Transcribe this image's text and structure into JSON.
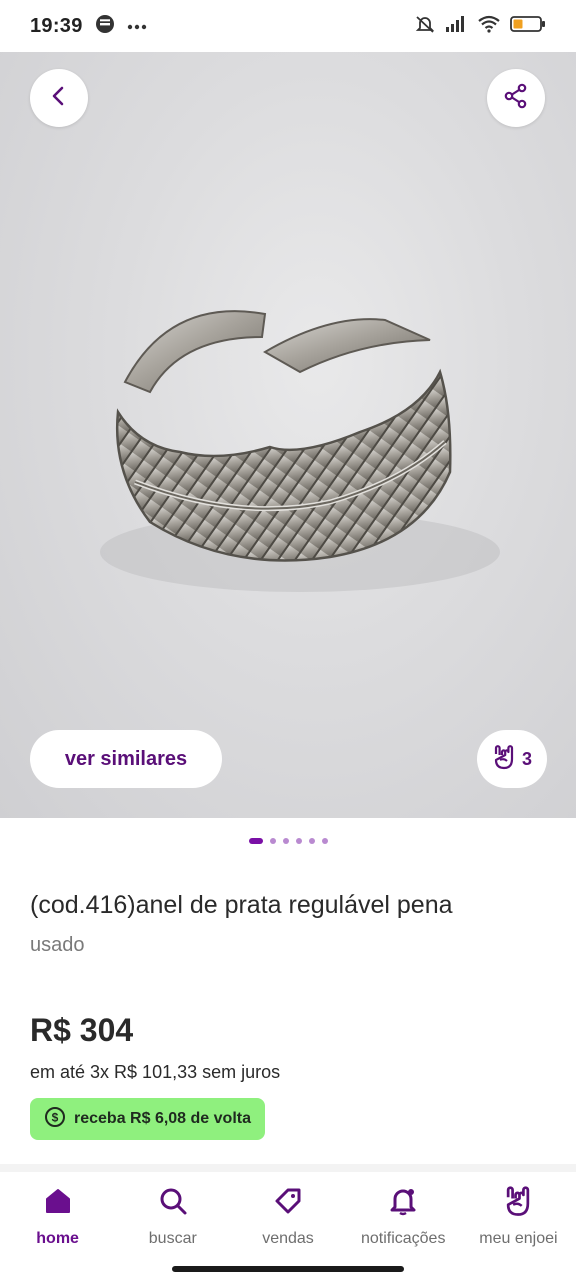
{
  "status_bar": {
    "time": "19:39",
    "icons": [
      "app-e-icon",
      "more-dots-icon",
      "bell-off-icon",
      "signal-icon",
      "wifi-icon",
      "battery-icon"
    ]
  },
  "product": {
    "title": "(cod.416)anel de prata regulável pena",
    "condition": "usado",
    "price": "R$ 304",
    "installments": "em até 3x R$ 101,33 sem juros",
    "cashback": "receba R$ 6,08 de volta"
  },
  "gallery": {
    "similar_label": "ver similares",
    "likes_count": "3",
    "image_count": 6,
    "active_index": 0
  },
  "nav": {
    "items": [
      {
        "label": "home",
        "icon": "home-icon",
        "active": true
      },
      {
        "label": "buscar",
        "icon": "search-icon",
        "active": false
      },
      {
        "label": "vendas",
        "icon": "tag-icon",
        "active": false
      },
      {
        "label": "notificações",
        "icon": "bell-icon",
        "active": false
      },
      {
        "label": "meu enjoei",
        "icon": "rock-hand-icon",
        "active": false
      }
    ]
  },
  "colors": {
    "brand_purple": "#6a0f8e",
    "cashback_green": "#8ff07e"
  }
}
